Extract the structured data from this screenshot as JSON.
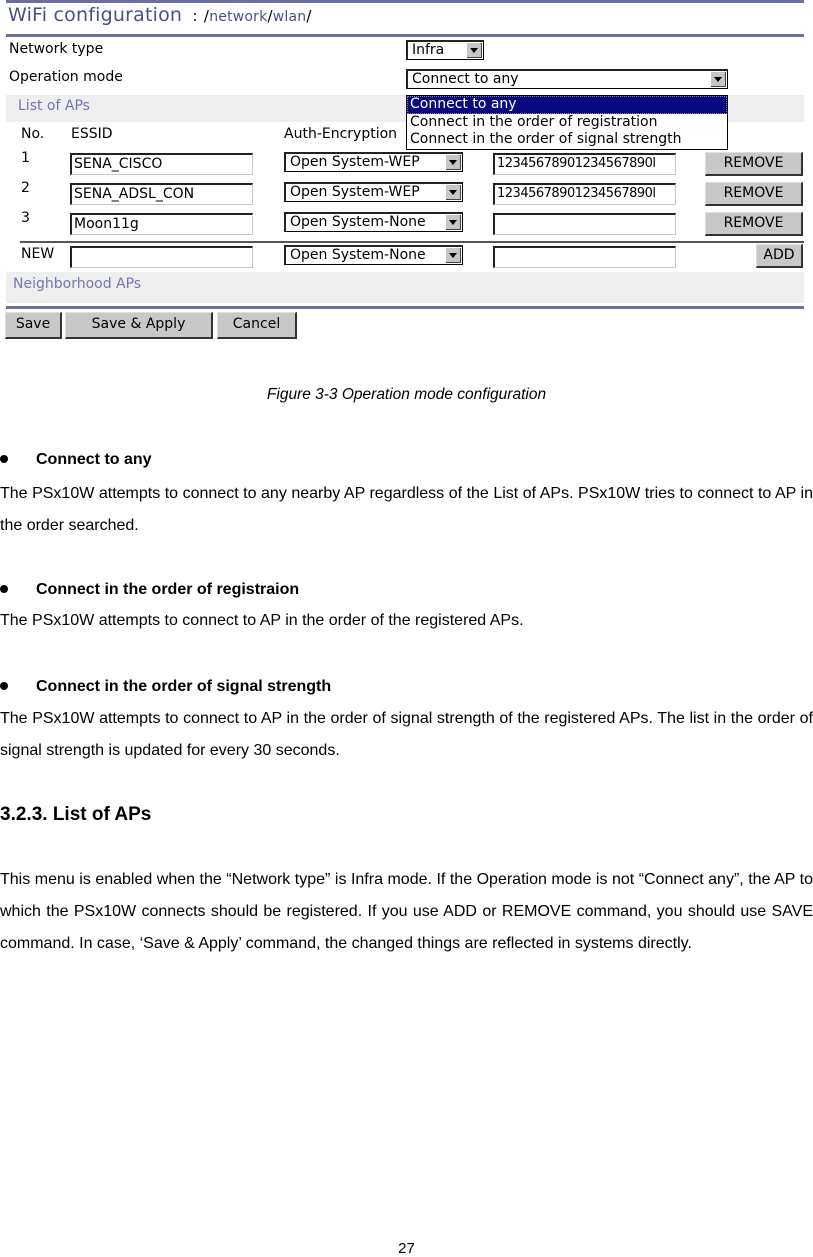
{
  "figure": {
    "title": "WiFi configuration",
    "title_separator": ":",
    "path": [
      "network",
      "wlan"
    ],
    "network_type": {
      "label": "Network type",
      "value": "Infra"
    },
    "operation_mode": {
      "label": "Operation mode",
      "value": "Connect to any",
      "options": [
        "Connect to any",
        "Connect in the order of registration",
        "Connect in the order of signal strength"
      ],
      "highlighted_option": "Connect to any"
    },
    "list_of_aps": {
      "section_label": "List of APs",
      "columns": [
        "No.",
        "ESSID",
        "Auth-Encryption"
      ],
      "rows": [
        {
          "no": "1",
          "essid": "SENA_CISCO",
          "auth": "Open System-WEP",
          "key": "12345678901234567890l",
          "action": "REMOVE"
        },
        {
          "no": "2",
          "essid": "SENA_ADSL_CON",
          "auth": "Open System-WEP",
          "key": "12345678901234567890l",
          "action": "REMOVE"
        },
        {
          "no": "3",
          "essid": "Moon11g",
          "auth": "Open System-None",
          "key": "",
          "action": "REMOVE"
        }
      ],
      "new_row": {
        "no": "NEW",
        "essid": "",
        "auth": "Open System-None",
        "key": "",
        "action": "ADD"
      }
    },
    "neighborhood_aps": {
      "section_label": "Neighborhood APs"
    },
    "buttons": {
      "save": "Save",
      "save_apply": "Save & Apply",
      "cancel": "Cancel"
    },
    "colors": {
      "title": "#4a4e8e",
      "rule": "#6b6fa0",
      "section_label": "#7476b0",
      "band": "#eeeeee",
      "selection": "#0a0a80"
    }
  },
  "caption": "Figure 3-3 Operation mode configuration",
  "sections": [
    {
      "bullet": "Connect to any",
      "text": "The PSx10W attempts to connect to any nearby AP regardless of the List of APs. PSx10W tries to connect to AP in the order searched."
    },
    {
      "bullet": "Connect in the order of registraion",
      "text": "The PSx10W attempts to connect to AP in the order of the registered APs."
    },
    {
      "bullet": "Connect in the order of signal strength",
      "text": "The PSx10W attempts to connect to AP in the order of signal strength of the registered APs. The list in the order of signal strength is updated for every 30 seconds."
    }
  ],
  "heading": "3.2.3. List of APs",
  "list_of_aps_text": "This menu is enabled when the “Network type” is Infra mode. If the Operation mode is not “Connect any”, the AP to which the PSx10W connects should be registered. If you use ADD or REMOVE command, you should use SAVE command. In case, ‘Save & Apply’ command, the changed things are reflected in systems directly.",
  "page_number": "27"
}
